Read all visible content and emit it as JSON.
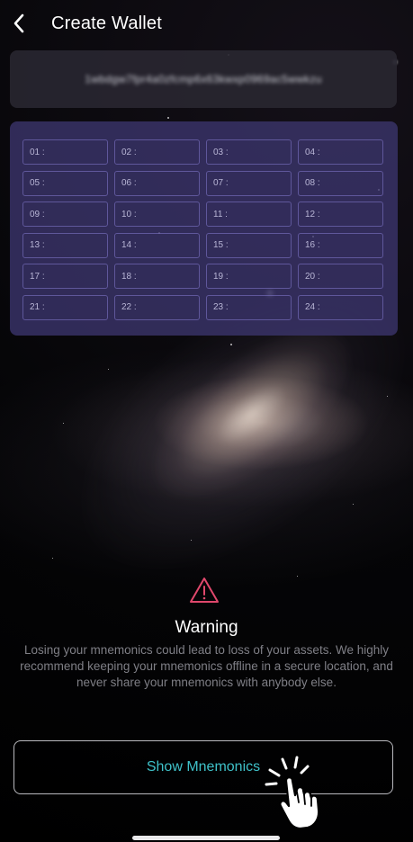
{
  "header": {
    "title": "Create Wallet",
    "back_icon": "chevron-left-icon"
  },
  "address": {
    "value": "1wbdgw7fpr4a0zfcmp6x63kwxp0969ac5wwkzu",
    "blurred": true
  },
  "mnemonics": {
    "cells": [
      "01 :",
      "02 :",
      "03 :",
      "04 :",
      "05 :",
      "06 :",
      "07 :",
      "08 :",
      "09 :",
      "10 :",
      "11 :",
      "12 :",
      "13 :",
      "14 :",
      "15 :",
      "16 :",
      "17 :",
      "18 :",
      "19 :",
      "20 :",
      "21 :",
      "22 :",
      "23 :",
      "24 :"
    ]
  },
  "warning": {
    "icon": "warning-triangle-icon",
    "icon_color": "#e0486c",
    "title": "Warning",
    "body": "Losing your mnemonics could lead to loss of your assets. We highly recommend keeping your mnemonics offline in a secure location, and never share your mnemonics with anybody else."
  },
  "actions": {
    "show_mnemonics_label": "Show Mnemonics",
    "label_color": "#3fc1c9",
    "tap_icon": "tap-hand-icon"
  }
}
